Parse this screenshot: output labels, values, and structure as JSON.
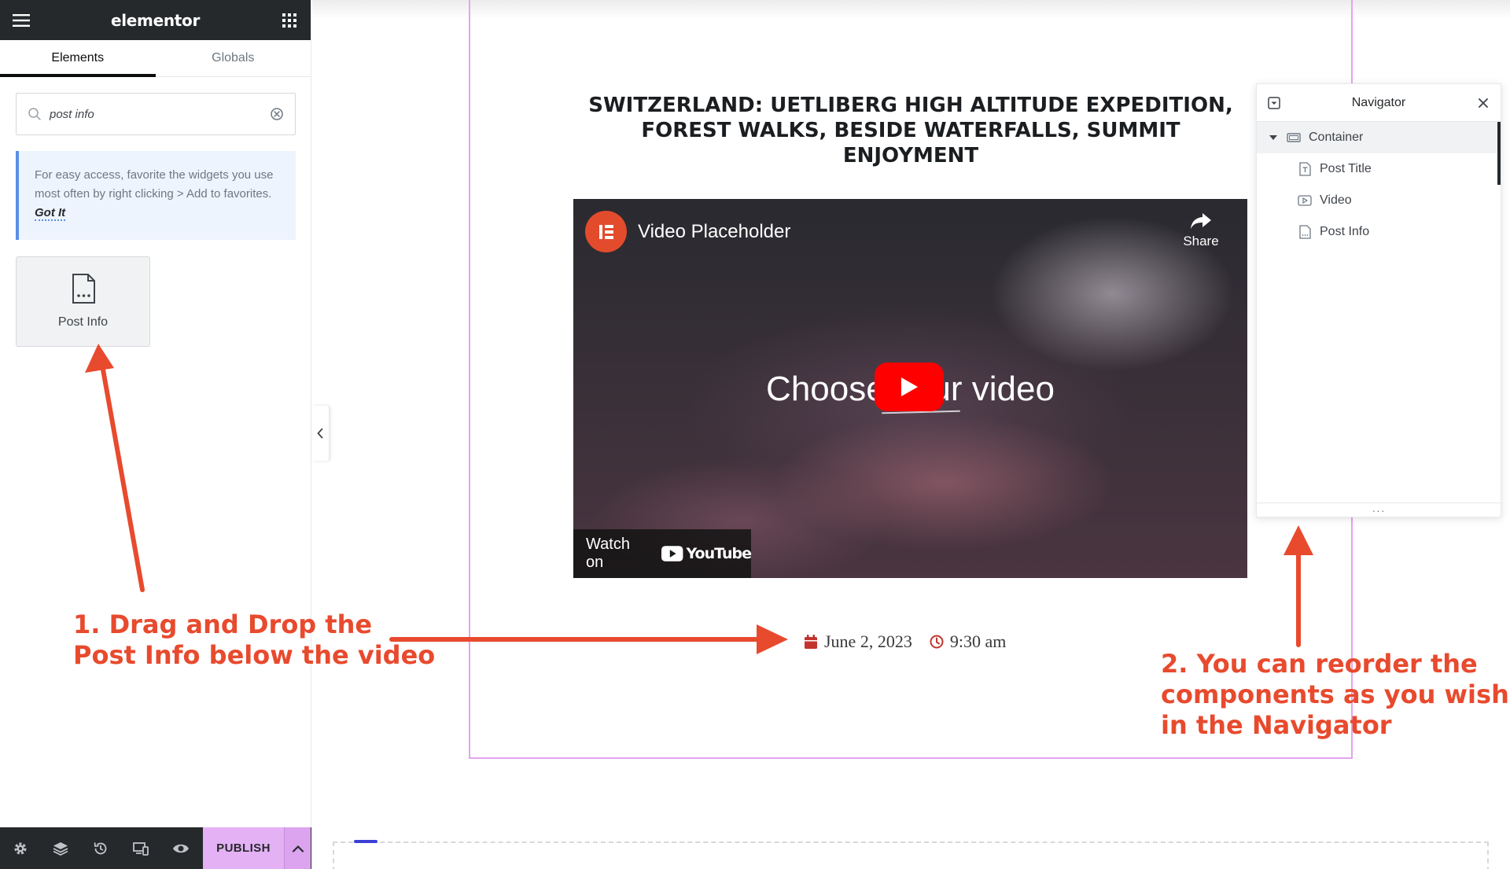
{
  "app": {
    "logo": "elementor",
    "tabs": [
      {
        "label": "Elements",
        "active": true
      },
      {
        "label": "Globals",
        "active": false
      }
    ],
    "search": {
      "value": "post info",
      "placeholder": "Search Widget..."
    },
    "tip": {
      "text": "For easy access, favorite the widgets you use most often by right clicking > Add to favorites.",
      "link": "Got It"
    },
    "widget": {
      "label": "Post Info",
      "icon": "post-info-icon"
    },
    "footer": {
      "publish_label": "PUBLISH",
      "icons": [
        "settings-icon",
        "layers-icon",
        "history-icon",
        "responsive-icon",
        "preview-icon"
      ]
    },
    "accent": "#e4b1f5"
  },
  "canvas": {
    "post_title_line1": "SWITZERLAND: UETLIBERG HIGH ALTITUDE EXPEDITION,",
    "post_title_line2": "FOREST WALKS, BESIDE WATERFALLS, SUMMIT ENJOYMENT",
    "video": {
      "title": "Video Placeholder",
      "share_label": "Share",
      "headline": "Choose your video",
      "watch_label": "Watch on",
      "platform": "YouTube"
    },
    "post_info": {
      "date": "June 2, 2023",
      "time": "9:30 am"
    },
    "frame_color": "#e3a4ee"
  },
  "navigator": {
    "title": "Navigator",
    "items": [
      {
        "label": "Container",
        "icon": "container-icon",
        "expanded": true
      },
      {
        "label": "Post Title",
        "icon": "post-title-icon"
      },
      {
        "label": "Video",
        "icon": "video-icon"
      },
      {
        "label": "Post Info",
        "icon": "post-info-icon"
      }
    ]
  },
  "annotations": {
    "step1_line1": "1. Drag and Drop the",
    "step1_line2": "Post Info below the video",
    "step2_line1": "2. You can reorder the",
    "step2_line2": "components as you wish",
    "step2_line3": "in the Navigator",
    "color": "#e84a2e"
  }
}
